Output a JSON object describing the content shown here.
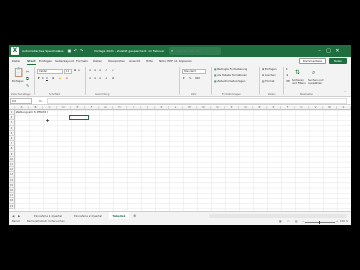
{
  "titlebar": {
    "autosave_label": "Automatisches Speichern",
    "autosave_state": "Aus",
    "document_title": "Vorlage 2021 - Zuletzt gespeichert: 11 Februar",
    "search_placeholder": "Suchen (Alt+M)"
  },
  "ribbon_tabs": [
    "Datei",
    "Start",
    "Einfügen",
    "Seitenlayout",
    "Formeln",
    "Daten",
    "Überprüfen",
    "Ansicht",
    "Hilfe",
    "Nitro PDF 11 Kopieren"
  ],
  "active_ribbon_tab": "Start",
  "header_buttons": {
    "comments": "Kommentare",
    "share": "Teilen"
  },
  "ribbon": {
    "clipboard": {
      "paste": "Einfügen",
      "label": "Zwischenablage"
    },
    "font": {
      "name": "Calibri",
      "size": "11",
      "label": "Schriftart"
    },
    "alignment": {
      "label": "Ausrichtung"
    },
    "number": {
      "format": "Standard",
      "label": "Zahl"
    },
    "styles": {
      "conditional": "Bedingte Formatierung",
      "as_table": "Als Tabelle formatieren",
      "cell_styles": "Zellenformatvorlagen",
      "label": "Formatvorlagen"
    },
    "cells": {
      "insert": "Einfügen",
      "delete": "Löschen",
      "format": "Format",
      "label": "Zellen"
    },
    "editing": {
      "sort": "Sortieren und Filtern",
      "find": "Suchen und Auswählen",
      "label": "Bearbeiten"
    }
  },
  "formula_bar": {
    "name_box": "C2",
    "fx": "fx",
    "formula": ""
  },
  "grid": {
    "columns": [
      "A",
      "B",
      "C",
      "D",
      "E",
      "F",
      "G",
      "H",
      "I",
      "J",
      "K",
      "L",
      "M",
      "N",
      "O",
      "P",
      "Q",
      "R",
      "S",
      "T",
      "U",
      "V",
      "W",
      "X"
    ],
    "rows": [
      "1",
      "2",
      "3",
      "4",
      "5",
      "6",
      "7",
      "8",
      "9",
      "10",
      "11",
      "12",
      "13",
      "14",
      "15",
      "16",
      "17",
      "18",
      "19"
    ],
    "cell_A1": "Zahlung am 3. Pflicht I"
  },
  "sheets": [
    "Einnahme 1.Quartal",
    "Einnahme 2.Quartal",
    "Tabelle1"
  ],
  "active_sheet": "Tabelle1",
  "status": {
    "ready": "Bereit",
    "accessibility": "Barrierefreiheit: Untersuchen",
    "zoom": "100 %"
  },
  "colors": {
    "accent": "#1e6e3f"
  }
}
